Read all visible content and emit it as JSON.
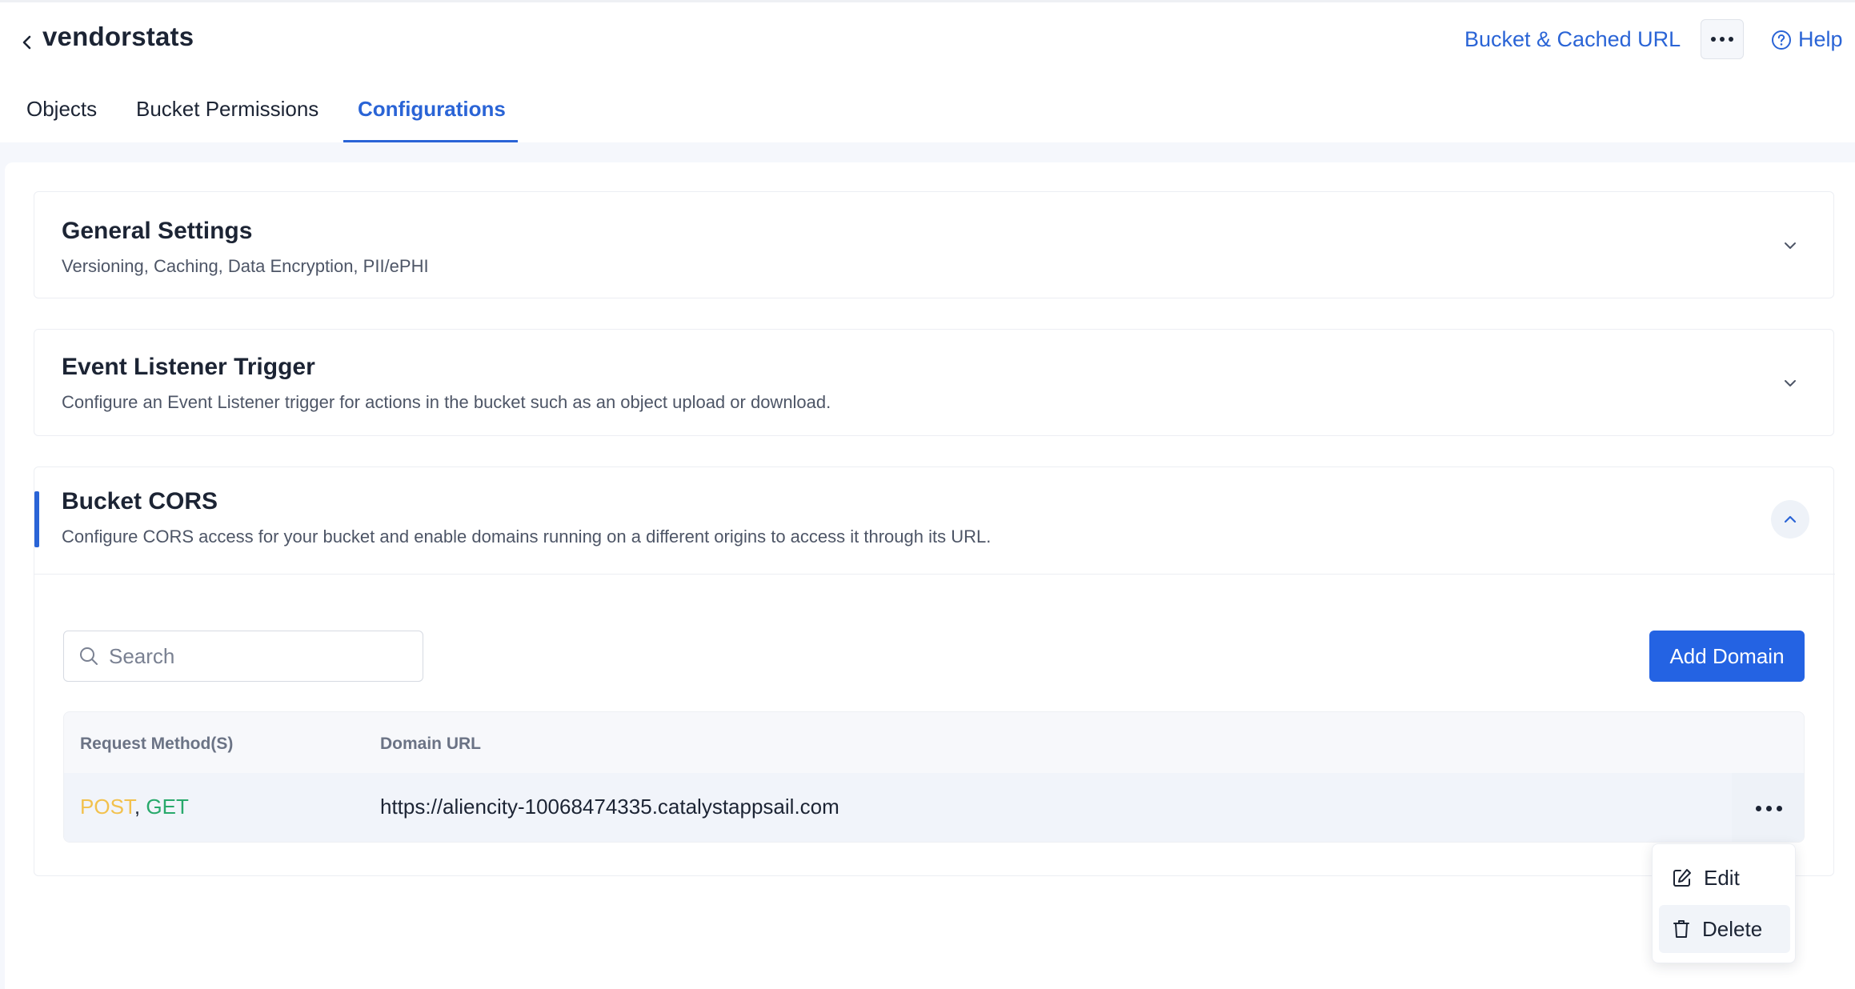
{
  "header": {
    "title": "vendorstats",
    "bucket_link": "Bucket & Cached URL",
    "help_label": "Help"
  },
  "tabs": [
    {
      "label": "Objects"
    },
    {
      "label": "Bucket Permissions"
    },
    {
      "label": "Configurations"
    }
  ],
  "sections": {
    "general": {
      "title": "General Settings",
      "subtitle": "Versioning, Caching, Data Encryption, PII/ePHI"
    },
    "event": {
      "title": "Event Listener Trigger",
      "subtitle": "Configure an Event Listener trigger for actions in the bucket such as an object upload or download."
    },
    "cors": {
      "title": "Bucket CORS",
      "subtitle": "Configure CORS access for your bucket and enable domains running on a different origins to access it through its URL.",
      "search_placeholder": "Search",
      "add_button": "Add Domain",
      "columns": [
        "Request Method(S)",
        "Domain URL"
      ],
      "rows": [
        {
          "methods": [
            "POST",
            "GET"
          ],
          "separator": ",",
          "domain": "https://aliencity-10068474335.catalystappsail.com"
        }
      ]
    }
  },
  "row_menu": {
    "edit_label": "Edit",
    "delete_label": "Delete"
  },
  "colors": {
    "accent": "#2a64d6",
    "primary_button": "#2463e3",
    "method_post": "#f2c14d",
    "method_get": "#28a96b"
  }
}
